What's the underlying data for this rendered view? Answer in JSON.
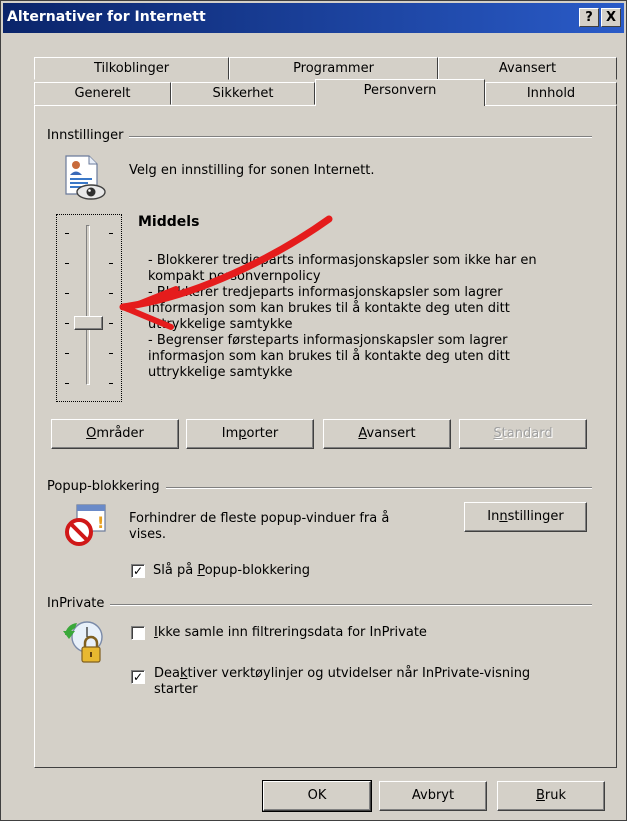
{
  "window": {
    "title": "Alternativer for Internett",
    "help_label": "?",
    "close_label": "X"
  },
  "tabs": {
    "row_back": [
      "Tilkoblinger",
      "Programmer",
      "Avansert"
    ],
    "row_front": [
      "Generelt",
      "Sikkerhet",
      "Personvern",
      "Innhold"
    ],
    "active": "Personvern"
  },
  "settings": {
    "group_label": "Innstillinger",
    "intro": "Velg en innstilling for sonen Internett.",
    "level_title": "Middels",
    "level_fraction": 0.4,
    "level_ticks": 6,
    "description_lines": [
      "- Blokkerer tredjeparts informasjonskapsler som ikke har en",
      "kompakt personvernpolicy",
      "- Blokkerer tredjeparts informasjonskapsler som lagrer",
      "informasjon som kan brukes til å kontakte deg uten ditt",
      "uttrykkelige samtykke",
      "- Begrenser førsteparts informasjonskapsler som lagrer",
      "informasjon som kan brukes til å kontakte deg uten ditt",
      "uttrykkelige samtykke"
    ],
    "buttons": {
      "sites": {
        "before": "",
        "key": "O",
        "after": "mråder"
      },
      "import": {
        "before": "Im",
        "key": "p",
        "after": "orter"
      },
      "advanced": {
        "before": "",
        "key": "A",
        "after": "vansert"
      },
      "default": {
        "before": "",
        "key": "S",
        "after": "tandard"
      }
    }
  },
  "popup": {
    "group_label": "Popup-blokkering",
    "description_line1": "Forhindrer de fleste popup-vinduer fra å",
    "description_line2": "vises.",
    "settings_button": {
      "before": "In",
      "key": "n",
      "after": "stillinger"
    },
    "checkbox": {
      "before": "Slå på ",
      "key": "P",
      "after": "opup-blokkering",
      "checked": true
    }
  },
  "inprivate": {
    "group_label": "InPrivate",
    "checkbox1": {
      "before": "",
      "key": "I",
      "after": "kke samle inn filtreringsdata for InPrivate",
      "checked": false
    },
    "checkbox2": {
      "before": "Dea",
      "key": "k",
      "after": "tiver verktøylinjer og utvidelser når InPrivate-visning",
      "line2": "starter",
      "checked": true
    }
  },
  "footer": {
    "ok": "OK",
    "cancel": "Avbryt",
    "apply": {
      "before": "",
      "key": "B",
      "after": "ruk"
    }
  },
  "colors": {
    "face": "#d4d0c8",
    "title_bar": "#0a246a",
    "annotation_arrow": "#e51c1c"
  },
  "icons": {
    "settings": "privacy-document-eye-icon",
    "popup": "popup-blocked-icon",
    "inprivate": "inprivate-lock-icon",
    "annotation": "red-arrow-annotation"
  }
}
